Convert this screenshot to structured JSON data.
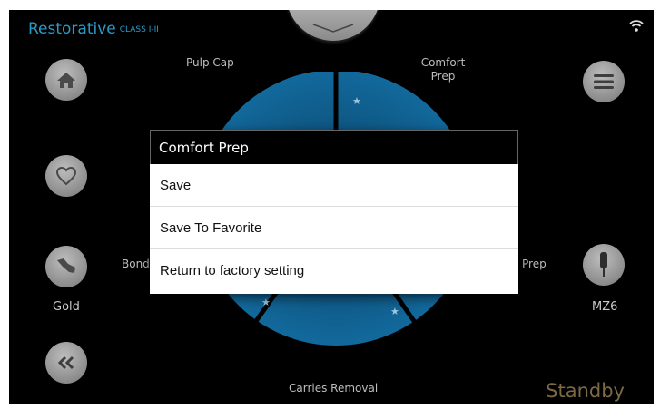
{
  "header": {
    "title": "Restorative",
    "subtitle": "CLASS I-II"
  },
  "status": {
    "mode": "Standby"
  },
  "left_panel": {
    "restoration_label": "Gold"
  },
  "right_panel": {
    "handpiece_label": "MZ6"
  },
  "wheel": {
    "segments": [
      "Pulp Cap",
      "Comfort Prep",
      "Bond",
      "Prep",
      "Carries Removal"
    ]
  },
  "dialog": {
    "title": "Comfort Prep",
    "items": [
      "Save",
      "Save To Favorite",
      "Return to factory setting"
    ]
  },
  "colors": {
    "accent": "#2a9ac9",
    "standby": "#7c6a45",
    "wheel": "#0f5f8f"
  }
}
